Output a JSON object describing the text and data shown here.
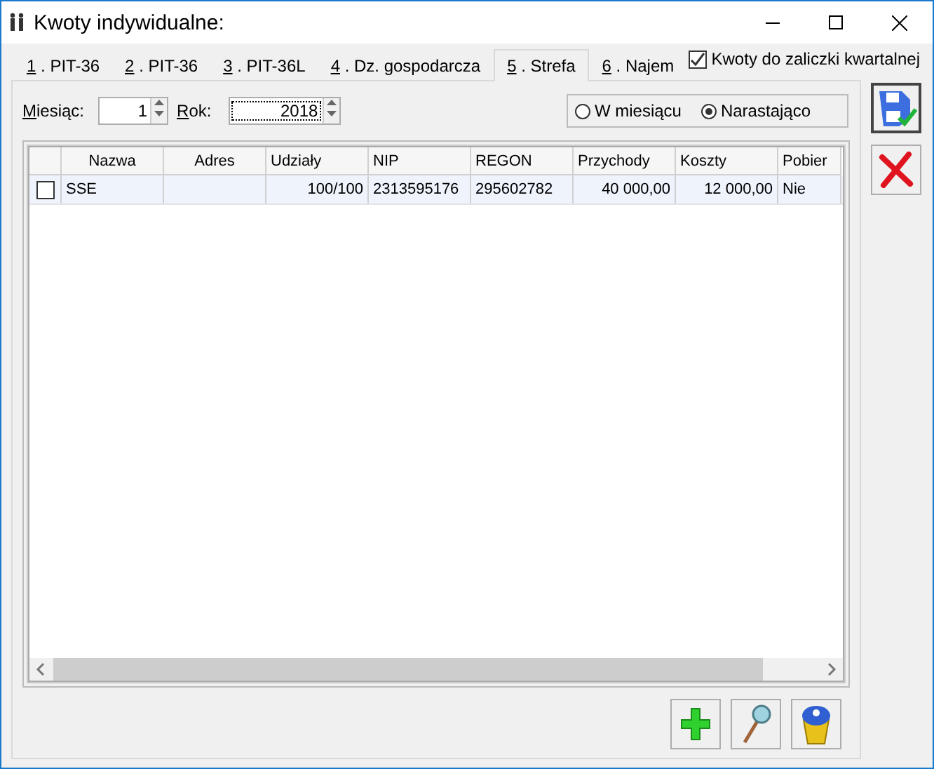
{
  "window": {
    "title": "Kwoty indywidualne:"
  },
  "tabs": [
    {
      "label": "1 . PIT-36",
      "selected": false
    },
    {
      "label": "2 . PIT-36",
      "selected": false
    },
    {
      "label": "3 . PIT-36L",
      "selected": false
    },
    {
      "label": "4 . Dz. gospodarcza",
      "selected": false
    },
    {
      "label": "5 . Strefa",
      "selected": true
    },
    {
      "label": "6 . Najem",
      "selected": false
    }
  ],
  "quarterly_checkbox": {
    "label": "Kwoty do zaliczki kwartalnej",
    "checked": true
  },
  "filters": {
    "month": {
      "label": "Miesiąc:",
      "value": "1"
    },
    "year": {
      "label": "Rok:",
      "value": "2018"
    },
    "period": [
      {
        "label": "W miesiącu",
        "selected": false
      },
      {
        "label": "Narastająco",
        "selected": true
      }
    ]
  },
  "table": {
    "columns": [
      "Nazwa",
      "Adres",
      "Udziały",
      "NIP",
      "REGON",
      "Przychody",
      "Koszty",
      "Pobier"
    ],
    "rows": [
      {
        "checked": false,
        "cells": [
          "SSE",
          "",
          "100/100",
          "2313595176",
          "295602782",
          "40 000,00",
          "12 000,00",
          "Nie"
        ]
      }
    ]
  }
}
